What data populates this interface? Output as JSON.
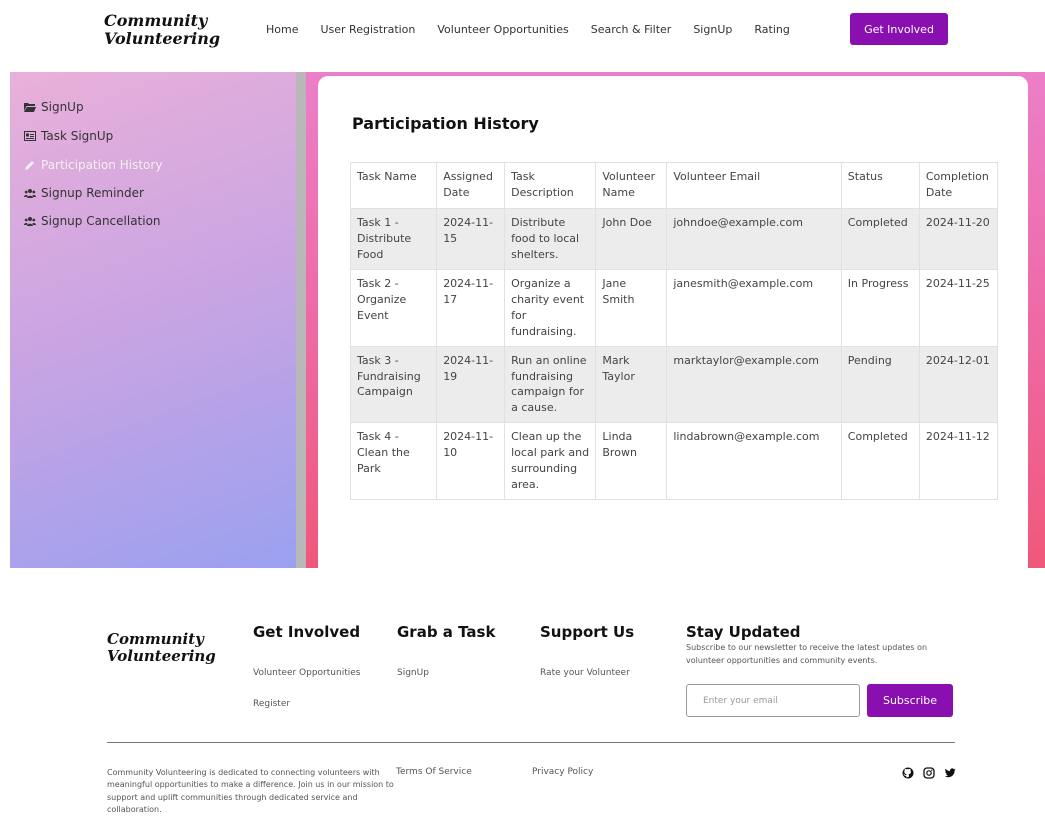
{
  "brand": {
    "line1": "Community",
    "line2": "Volunteering"
  },
  "nav": {
    "items": [
      "Home",
      "User Registration",
      "Volunteer Opportunities",
      "Search & Filter",
      "SignUp",
      "Rating"
    ],
    "cta": "Get Involved"
  },
  "sidebar": {
    "items": [
      {
        "label": "SignUp",
        "icon": "folder-open-icon"
      },
      {
        "label": "Task SignUp",
        "icon": "id-card-icon"
      },
      {
        "label": "Participation History",
        "icon": "pencil-icon"
      },
      {
        "label": "Signup Reminder",
        "icon": "users-icon"
      },
      {
        "label": "Signup Cancellation",
        "icon": "users-icon"
      }
    ]
  },
  "main": {
    "title": "Participation History",
    "table": {
      "headers": [
        "Task Name",
        "Assigned Date",
        "Task Description",
        "Volunteer Name",
        "Volunteer Email",
        "Status",
        "Completion Date"
      ],
      "rows": [
        [
          "Task 1 - Distribute Food",
          "2024-11-15",
          "Distribute food to local shelters.",
          "John Doe",
          "johndoe@example.com",
          "Completed",
          "2024-11-20"
        ],
        [
          "Task 2 - Organize Event",
          "2024-11-17",
          "Organize a charity event for fundraising.",
          "Jane Smith",
          "janesmith@example.com",
          "In Progress",
          "2024-11-25"
        ],
        [
          "Task 3 - Fundraising Campaign",
          "2024-11-19",
          "Run an online fundraising campaign for a cause.",
          "Mark Taylor",
          "marktaylor@example.com",
          "Pending",
          "2024-12-01"
        ],
        [
          "Task 4 - Clean the Park",
          "2024-11-10",
          "Clean up the local park and surrounding area.",
          "Linda Brown",
          "lindabrown@example.com",
          "Completed",
          "2024-11-12"
        ]
      ]
    }
  },
  "footer": {
    "get_involved": {
      "title": "Get Involved",
      "links": [
        "Volunteer Opportunities",
        "Register"
      ]
    },
    "grab_task": {
      "title": "Grab a Task",
      "links": [
        "SignUp"
      ]
    },
    "support": {
      "title": "Support Us",
      "links": [
        "Rate your Volunteer"
      ]
    },
    "stay": {
      "title": "Stay Updated",
      "text": "Subscribe to our newsletter to receive the latest updates on volunteer opportunities and community events.",
      "placeholder": "Enter your email",
      "button": "Subscribe"
    },
    "about": "Community Volunteering is dedicated to connecting volunteers with meaningful opportunities to make a difference. Join us in our mission to support and uplift communities through dedicated service and collaboration.",
    "terms": "Terms Of Service",
    "privacy": "Privacy Policy",
    "social": [
      "github-icon",
      "instagram-icon",
      "twitter-icon"
    ]
  },
  "colors": {
    "accent": "#8a0fb0",
    "sidebar_start": "#e9b0d9",
    "sidebar_end": "#9aa0f0",
    "content_start": "#ec7fc9",
    "content_end": "#f0587a"
  }
}
